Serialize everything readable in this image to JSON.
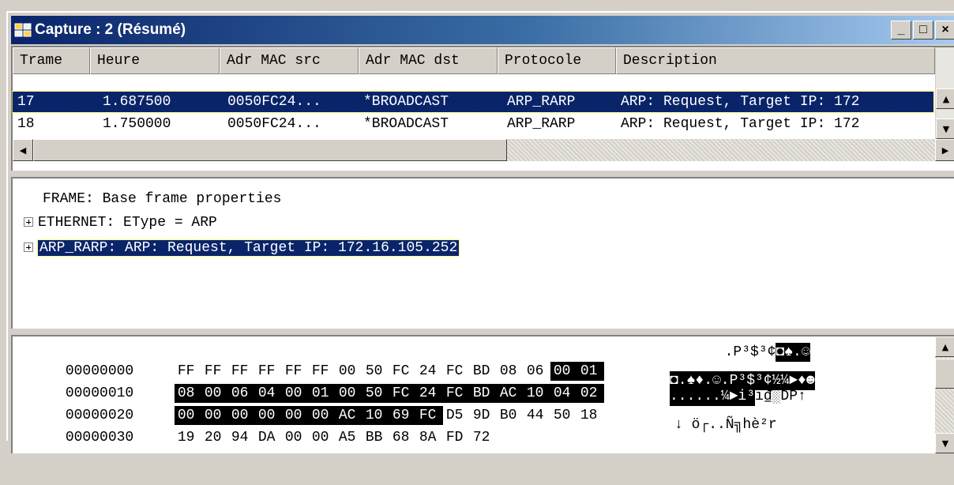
{
  "window": {
    "title": "Capture : 2 (Résumé)",
    "icon": "capture-app-icon",
    "controls": {
      "minimize": "_",
      "maximize": "□",
      "close": "×"
    }
  },
  "list": {
    "columns": [
      "Trame",
      "Heure",
      "Adr MAC src",
      "Adr MAC dst",
      "Protocole",
      "Description"
    ],
    "rows": [
      {
        "frame": "17",
        "time": "1.687500",
        "src": "0050FC24...",
        "dst": "*BROADCAST",
        "protocol": "ARP_RARP",
        "description": "ARP: Request, Target IP: 172",
        "selected": true
      },
      {
        "frame": "18",
        "time": "1.750000",
        "src": "0050FC24...",
        "dst": "*BROADCAST",
        "protocol": "ARP_RARP",
        "description": "ARP: Request, Target IP: 172",
        "selected": false
      }
    ]
  },
  "detail": {
    "items": [
      {
        "text": "FRAME: Base frame properties",
        "expandable": false,
        "selected": false
      },
      {
        "text": "ETHERNET:  EType = ARP",
        "expandable": true,
        "selected": false
      },
      {
        "text": "ARP_RARP: ARP: Request, Target IP: 172.16.105.252",
        "expandable": true,
        "selected": true
      }
    ]
  },
  "hex": {
    "rows": [
      {
        "offset": "00000000",
        "bytes": [
          "FF",
          "FF",
          "FF",
          "FF",
          "FF",
          "FF",
          "00",
          "50",
          "FC",
          "24",
          "FC",
          "BD",
          "08",
          "06",
          "00",
          "01"
        ],
        "ascii_plain": "  .P³$³¢",
        "ascii_hl": "◘♠.☺"
      },
      {
        "offset": "00000010",
        "bytes": [
          "08",
          "00",
          "06",
          "04",
          "00",
          "01",
          "00",
          "50",
          "FC",
          "24",
          "FC",
          "BD",
          "AC",
          "10",
          "04",
          "02"
        ],
        "ascii_plain": "",
        "ascii_hl": "◘.♠♦.☺.P³$³¢½¼►♦☻"
      },
      {
        "offset": "00000020",
        "bytes": [
          "00",
          "00",
          "00",
          "00",
          "00",
          "00",
          "AC",
          "10",
          "69",
          "FC",
          "D5",
          "9D",
          "B0",
          "44",
          "50",
          "18"
        ],
        "ascii_hl": "......¼►i³",
        "ascii_plain": "ı₫░DP↑"
      },
      {
        "offset": "00000030",
        "bytes": [
          "19",
          "20",
          "94",
          "DA",
          "00",
          "00",
          "A5",
          "BB",
          "68",
          "8A",
          "FD",
          "72"
        ],
        "ascii_plain": "↓ ö┌..Ñ╗hè²r",
        "ascii_hl": ""
      }
    ]
  }
}
